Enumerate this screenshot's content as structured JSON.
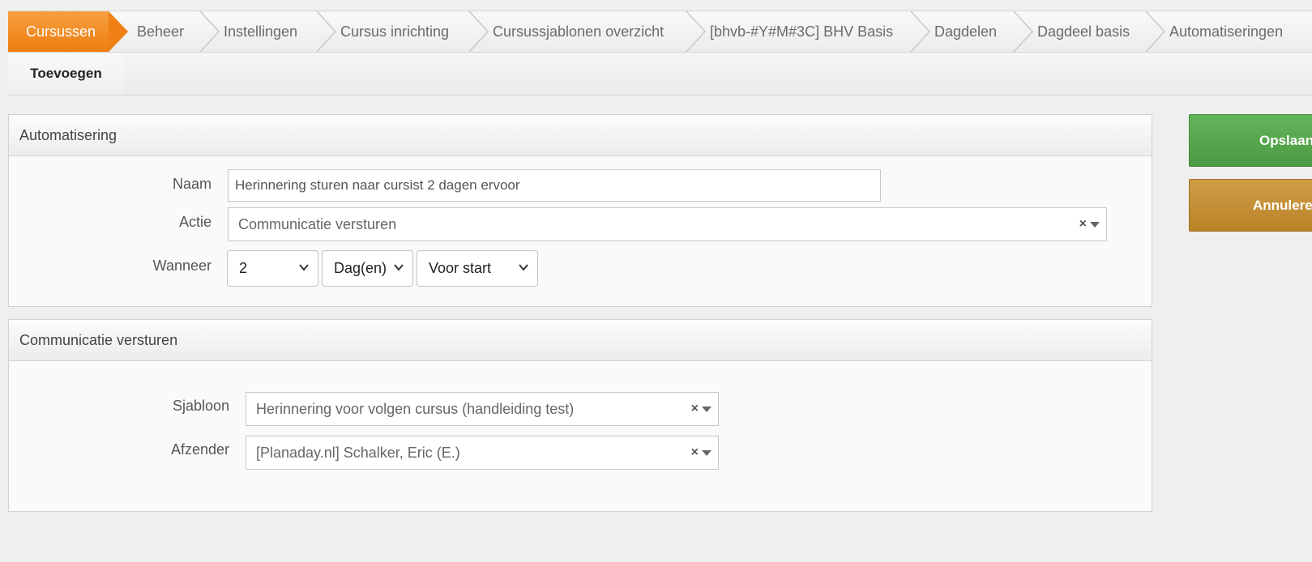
{
  "breadcrumb": {
    "items": [
      "Cursussen",
      "Beheer",
      "Instellingen",
      "Cursus inrichting",
      "Cursussjablonen overzicht",
      "[bhvb-#Y#M#3C] BHV Basis",
      "Dagdelen",
      "Dagdeel basis",
      "Automatiseringen"
    ]
  },
  "subnav": {
    "tab": "Toevoegen"
  },
  "automation_panel": {
    "title": "Automatisering",
    "naam_label": "Naam",
    "naam_value": "Herinnering sturen naar cursist 2 dagen ervoor",
    "actie_label": "Actie",
    "actie_value": "Communicatie versturen",
    "wanneer_label": "Wanneer",
    "wanneer_amount": "2",
    "wanneer_unit": "Dag(en)",
    "wanneer_relative": "Voor start"
  },
  "communication_panel": {
    "title": "Communicatie versturen",
    "sjabloon_label": "Sjabloon",
    "sjabloon_value": "Herinnering voor volgen cursus (handleiding test)",
    "afzender_label": "Afzender",
    "afzender_value": "[Planaday.nl] Schalker, Eric (E.)"
  },
  "actions": {
    "save_label": "Opslaan",
    "cancel_label": "Annuleren"
  },
  "colors": {
    "active_crumb": "#f08a1c",
    "save": "#56a64e",
    "cancel": "#c48f35"
  }
}
